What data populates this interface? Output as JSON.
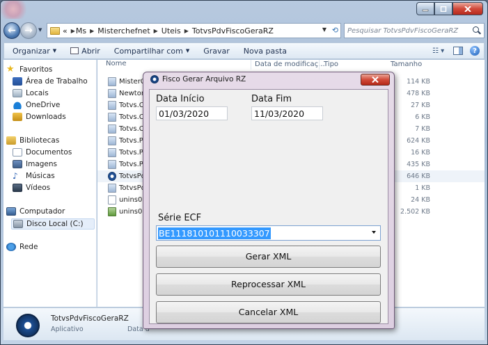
{
  "explorer": {
    "breadcrumbs": [
      "«",
      "Ms",
      "Misterchefnet",
      "Uteis",
      "TotvsPdvFiscoGeraRZ"
    ],
    "search_placeholder": "Pesquisar TotvsPdvFiscoGeraRZ",
    "toolbar": {
      "organize": "Organizar",
      "open": "Abrir",
      "share": "Compartilhar com",
      "record": "Gravar",
      "new_folder": "Nova pasta"
    },
    "nav": {
      "favorites": "Favoritos",
      "desktop": "Área de Trabalho",
      "locais": "Locais",
      "onedrive": "OneDrive",
      "downloads": "Downloads",
      "libraries": "Bibliotecas",
      "documents": "Documentos",
      "images": "Imagens",
      "music": "Músicas",
      "videos": "Vídeos",
      "computer": "Computador",
      "local_disk": "Disco Local (C:)",
      "network": "Rede"
    },
    "columns": {
      "name": "Nome",
      "modified": "Data de modificaç...",
      "type": "Tipo",
      "size": "Tamanho"
    },
    "files": [
      {
        "name": "MisterCh",
        "size": "114 KB"
      },
      {
        "name": "Newtons",
        "size": "478 KB"
      },
      {
        "name": "Totvs.Ch",
        "size": "27 KB"
      },
      {
        "name": "Totvs.Ch",
        "size": "6 KB"
      },
      {
        "name": "Totvs.Ch",
        "size": "7 KB"
      },
      {
        "name": "Totvs.Pd",
        "size": "624 KB"
      },
      {
        "name": "Totvs.Pd",
        "size": "16 KB"
      },
      {
        "name": "Totvs.Pd",
        "size": "435 KB"
      },
      {
        "name": "TotvsPd",
        "size": "646 KB"
      },
      {
        "name": "TotvsPd",
        "size": "1 KB"
      },
      {
        "name": "unins00(",
        "size": "24 KB"
      },
      {
        "name": "unins000",
        "size": "2.502 KB"
      }
    ],
    "details": {
      "name": "TotvsPdvFiscoGeraRZ",
      "type": "Aplicativo",
      "date_label": "Data d"
    }
  },
  "dialog": {
    "title": "Fisco Gerar Arquivo RZ",
    "start_label": "Data Início",
    "start_value": "01/03/2020",
    "end_label": "Data Fim",
    "end_value": "11/03/2020",
    "serial_label": "Série ECF",
    "serial_value": "BE111810101110033307",
    "generate_button": "Gerar XML",
    "reprocess_button": "Reprocessar XML",
    "cancel_button": "Cancelar XML"
  }
}
